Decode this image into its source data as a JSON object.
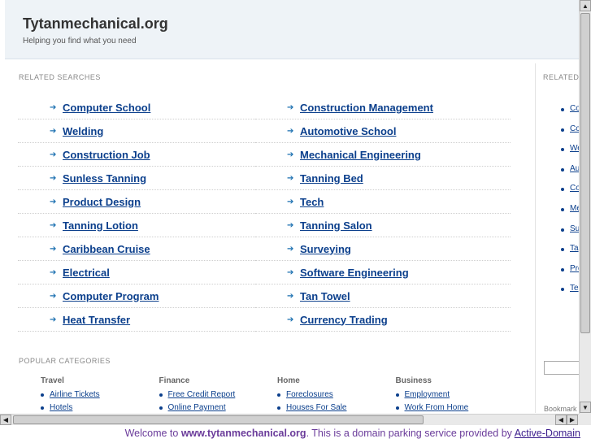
{
  "header": {
    "title": "Tytanmechanical.org",
    "tagline": "Helping you find what you need"
  },
  "related": {
    "label": "RELATED SEARCHES",
    "left": [
      "Computer School",
      "Welding",
      "Construction Job",
      "Sunless Tanning",
      "Product Design",
      "Tanning Lotion",
      "Caribbean Cruise",
      "Electrical",
      "Computer Program",
      "Heat Transfer"
    ],
    "right": [
      "Construction Management",
      "Automotive School",
      "Mechanical Engineering",
      "Tanning Bed",
      "Tech",
      "Tanning Salon",
      "Surveying",
      "Software Engineering",
      "Tan Towel",
      "Currency Trading"
    ]
  },
  "side": {
    "label": "RELATED",
    "items": [
      "Co",
      "Co",
      "We",
      "Au",
      "Co",
      "Me",
      "Su",
      "Ta",
      "Pro",
      "Te"
    ],
    "bookmark": "Bookmark"
  },
  "popular": {
    "label": "POPULAR CATEGORIES",
    "groups": [
      {
        "name": "Travel",
        "links": [
          "Airline Tickets",
          "Hotels"
        ]
      },
      {
        "name": "Finance",
        "links": [
          "Free Credit Report",
          "Online Payment"
        ]
      },
      {
        "name": "Home",
        "links": [
          "Foreclosures",
          "Houses For Sale"
        ]
      },
      {
        "name": "Business",
        "links": [
          "Employment",
          "Work From Home"
        ]
      }
    ]
  },
  "footer": {
    "prefix": "Welcome to ",
    "domain": "www.tytanmechanical.org",
    "middle": ". This is a domain parking service provided by ",
    "provider": "Active-Domain"
  },
  "scroll": {
    "up": "▲",
    "down": "▼",
    "left": "◀",
    "right": "▶",
    "grip": "::::"
  },
  "bullet_arrow": "➔"
}
